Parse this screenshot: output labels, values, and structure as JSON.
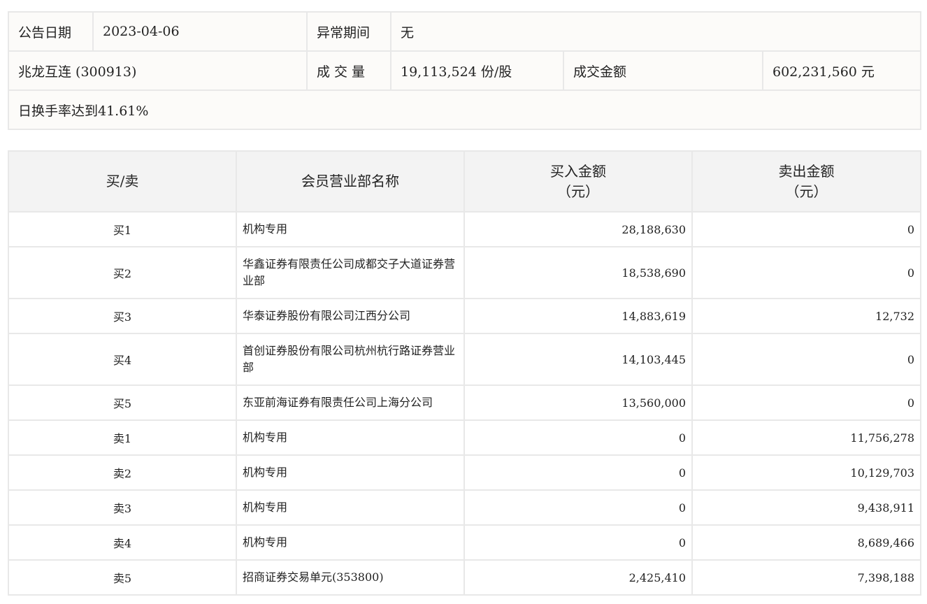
{
  "info": {
    "announce_date_label": "公告日期",
    "announce_date": "2023-04-06",
    "abnormal_period_label": "异常期间",
    "abnormal_period": "无",
    "stock": "兆龙互连 (300913)",
    "volume_label": "成交量",
    "volume": "19,113,524 份/股",
    "amount_label": "成交金额",
    "amount": "602,231,560 元",
    "reason": "日换手率达到41.61%"
  },
  "table": {
    "headers": {
      "side": "买/卖",
      "member": "会员营业部名称",
      "buy_line1": "买入金额",
      "buy_line2": "（元）",
      "sell_line1": "卖出金额",
      "sell_line2": "（元）"
    },
    "rows": [
      {
        "side": "买1",
        "name": "机构专用",
        "buy": "28,188,630",
        "sell": "0"
      },
      {
        "side": "买2",
        "name": "华鑫证券有限责任公司成都交子大道证券营业部",
        "buy": "18,538,690",
        "sell": "0"
      },
      {
        "side": "买3",
        "name": "华泰证券股份有限公司江西分公司",
        "buy": "14,883,619",
        "sell": "12,732"
      },
      {
        "side": "买4",
        "name": "首创证券股份有限公司杭州杭行路证券营业部",
        "buy": "14,103,445",
        "sell": "0"
      },
      {
        "side": "买5",
        "name": "东亚前海证券有限责任公司上海分公司",
        "buy": "13,560,000",
        "sell": "0"
      },
      {
        "side": "卖1",
        "name": "机构专用",
        "buy": "0",
        "sell": "11,756,278"
      },
      {
        "side": "卖2",
        "name": "机构专用",
        "buy": "0",
        "sell": "10,129,703"
      },
      {
        "side": "卖3",
        "name": "机构专用",
        "buy": "0",
        "sell": "9,438,911"
      },
      {
        "side": "卖4",
        "name": "机构专用",
        "buy": "0",
        "sell": "8,689,466"
      },
      {
        "side": "卖5",
        "name": "招商证券交易单元(353800)",
        "buy": "2,425,410",
        "sell": "7,398,188"
      }
    ]
  }
}
